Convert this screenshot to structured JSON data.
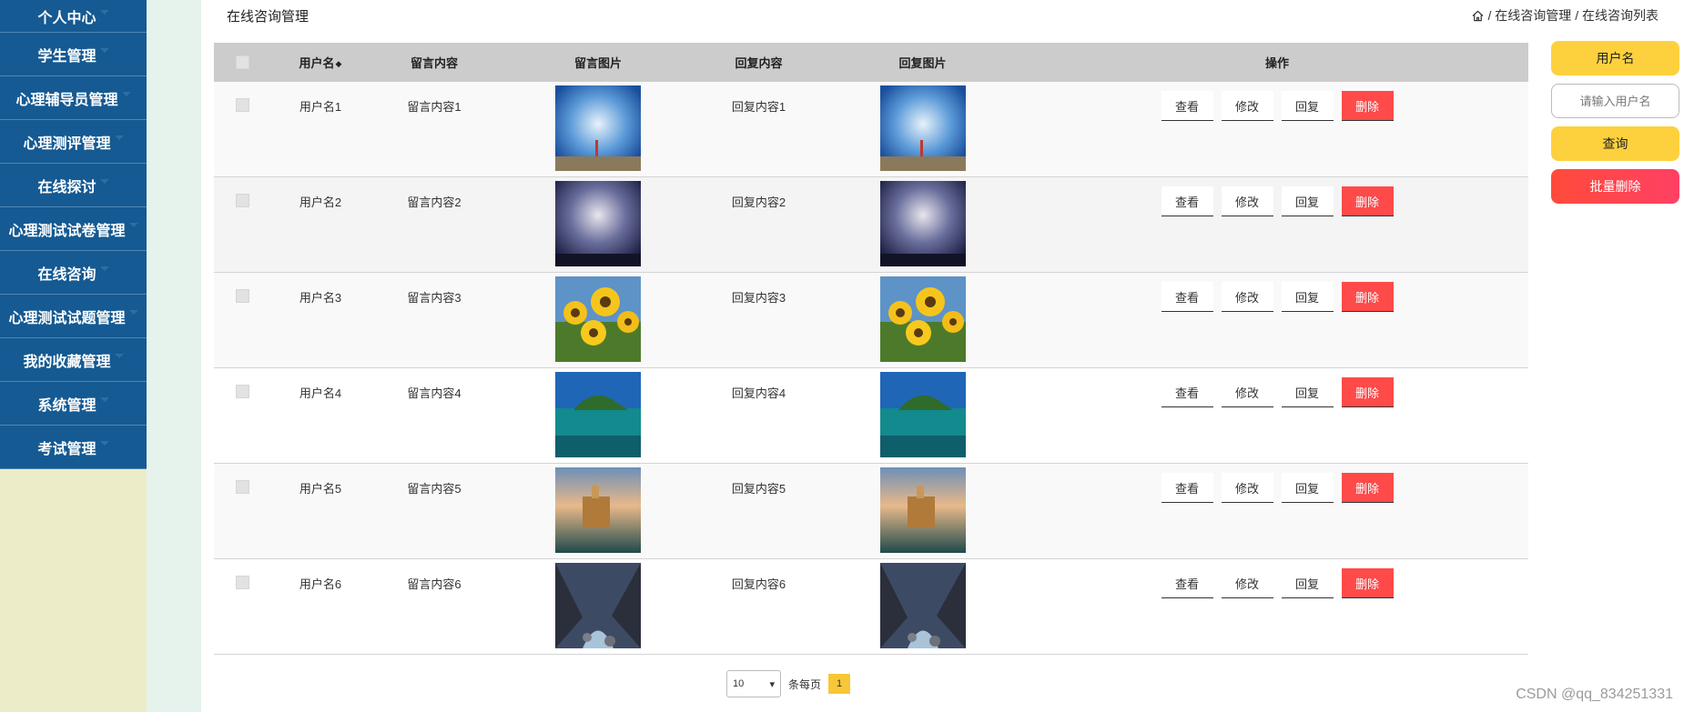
{
  "sidebar": {
    "items": [
      {
        "label": "个人中心"
      },
      {
        "label": "学生管理"
      },
      {
        "label": "心理辅导员管理"
      },
      {
        "label": "心理测评管理"
      },
      {
        "label": "在线探讨"
      },
      {
        "label": "心理测试试卷管理"
      },
      {
        "label": "在线咨询"
      },
      {
        "label": "心理测试试题管理"
      },
      {
        "label": "我的收藏管理"
      },
      {
        "label": "系统管理"
      },
      {
        "label": "考试管理"
      }
    ]
  },
  "header": {
    "title": "在线咨询管理",
    "breadcrumb": [
      "/ 在线咨询管理",
      "/ 在线咨询列表"
    ]
  },
  "table": {
    "columns": [
      "用户名",
      "留言内容",
      "留言图片",
      "回复内容",
      "回复图片",
      "操作"
    ],
    "rows": [
      {
        "user": "用户名1",
        "message": "留言内容1",
        "reply": "回复内容1"
      },
      {
        "user": "用户名2",
        "message": "留言内容2",
        "reply": "回复内容2"
      },
      {
        "user": "用户名3",
        "message": "留言内容3",
        "reply": "回复内容3"
      },
      {
        "user": "用户名4",
        "message": "留言内容4",
        "reply": "回复内容4"
      },
      {
        "user": "用户名5",
        "message": "留言内容5",
        "reply": "回复内容5"
      },
      {
        "user": "用户名6",
        "message": "留言内容6",
        "reply": "回复内容6"
      }
    ],
    "actions": {
      "view": "查看",
      "edit": "修改",
      "reply": "回复",
      "delete": "删除"
    }
  },
  "pager": {
    "page_size": "10",
    "per_page_label": "条每页",
    "current_page": "1"
  },
  "search": {
    "field_label": "用户名",
    "placeholder": "请输入用户名",
    "query_label": "查询",
    "batch_delete_label": "批量删除"
  },
  "watermark": "CSDN @qq_834251331",
  "colors": {
    "sidebar": "#155a92",
    "accent": "#fdd13e",
    "danger": "#ff4a4a",
    "header_bg": "#cccccc"
  }
}
